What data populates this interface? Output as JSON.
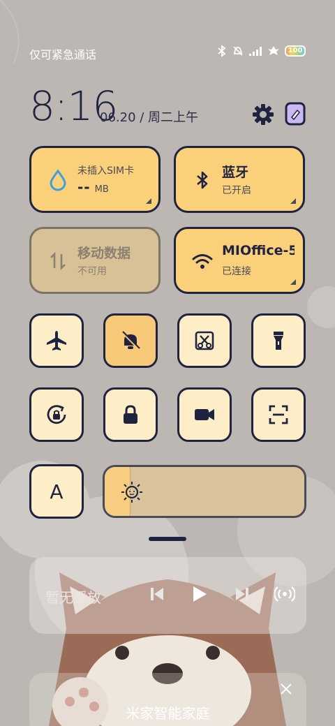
{
  "status_bar": {
    "carrier": "仅可紧急通话",
    "battery": "100"
  },
  "header": {
    "time": "8:16",
    "date": "06.20 / 周二上午",
    "icons": [
      "gear-icon",
      "edit-icon"
    ]
  },
  "tiles": {
    "sim": {
      "label": "未插入SIM卡",
      "value": "--",
      "unit": "MB",
      "icon": "water-drop-icon"
    },
    "bluetooth": {
      "title": "蓝牙",
      "status": "已开启",
      "icon": "bluetooth-icon"
    },
    "mobile_data": {
      "title": "移动数据",
      "status": "不可用",
      "icon": "data-arrows-icon"
    },
    "wifi": {
      "title": "MIOffice-5",
      "status": "已连接",
      "icon": "wifi-icon"
    }
  },
  "quick_toggles": [
    {
      "name": "airplane-mode",
      "icon": "airplane-icon",
      "active": false
    },
    {
      "name": "mute",
      "icon": "bell-off-icon",
      "active": true
    },
    {
      "name": "screenshot",
      "icon": "scissors-icon",
      "active": false
    },
    {
      "name": "flashlight",
      "icon": "flashlight-icon",
      "active": false
    },
    {
      "name": "rotation-lock",
      "icon": "rotation-lock-icon",
      "active": false
    },
    {
      "name": "lock-screen",
      "icon": "lock-icon",
      "active": false
    },
    {
      "name": "screen-record",
      "icon": "video-camera-icon",
      "active": false
    },
    {
      "name": "scanner",
      "icon": "scan-icon",
      "active": false
    }
  ],
  "font_size_toggle": {
    "label": "A"
  },
  "brightness": {
    "level": 0.13,
    "icon": "sun-icon"
  },
  "media": {
    "title": "暂无播放",
    "controls": [
      "previous-icon",
      "play-icon",
      "next-icon",
      "cast-icon"
    ]
  },
  "mijia": {
    "title": "米家智能家庭"
  },
  "colors": {
    "tile_active": "#fbd07a",
    "tile_light": "#fdeec7",
    "outline": "#1f2340",
    "background": "#bcb7b2"
  }
}
